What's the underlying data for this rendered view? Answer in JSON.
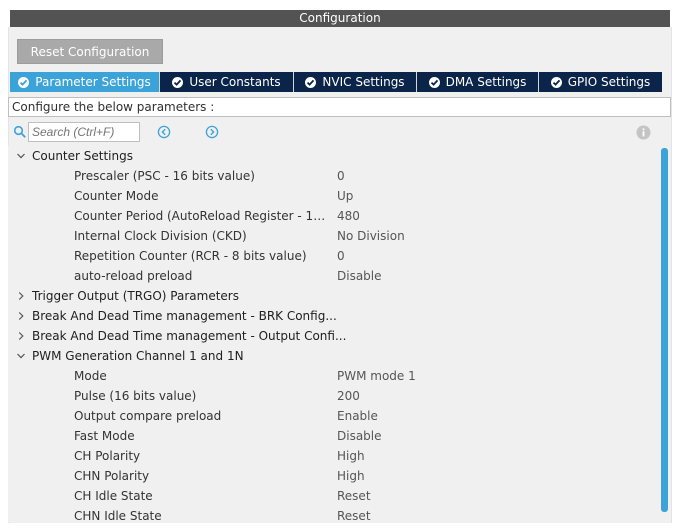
{
  "window": {
    "title": "Configuration"
  },
  "toolbar": {
    "reset_label": "Reset Configuration"
  },
  "tabs": [
    {
      "label": "Parameter Settings",
      "active": true
    },
    {
      "label": "User Constants",
      "active": false
    },
    {
      "label": "NVIC Settings",
      "active": false
    },
    {
      "label": "DMA Settings",
      "active": false
    },
    {
      "label": "GPIO Settings",
      "active": false
    }
  ],
  "description": "Configure the below parameters :",
  "search": {
    "placeholder": "Search (Ctrl+F)"
  },
  "icons": {
    "search": "search-icon",
    "prev": "arrow-left-circle-icon",
    "next": "arrow-right-circle-icon",
    "info": "info-icon",
    "expanded": "chevron-down-icon",
    "collapsed": "chevron-right-icon",
    "tab_check": "check-circle-icon"
  },
  "colors": {
    "accent": "#3ca3d8",
    "tab_bar": "#0b2449",
    "title_bar": "#535353"
  },
  "tree": {
    "counter_settings": {
      "label": "Counter Settings",
      "params": [
        {
          "name": "Prescaler (PSC - 16 bits value)",
          "value": "0"
        },
        {
          "name": "Counter Mode",
          "value": "Up"
        },
        {
          "name": "Counter Period (AutoReload Register - 16 ...",
          "value": "480"
        },
        {
          "name": "Internal Clock Division (CKD)",
          "value": "No Division"
        },
        {
          "name": "Repetition Counter (RCR - 8 bits value)",
          "value": "0"
        },
        {
          "name": "auto-reload preload",
          "value": "Disable"
        }
      ]
    },
    "trigger_output": {
      "label": "Trigger Output (TRGO) Parameters"
    },
    "brk_config": {
      "label": "Break And Dead Time management - BRK Config..."
    },
    "output_config": {
      "label": "Break And Dead Time management - Output Confi..."
    },
    "pwm_channel": {
      "label": "PWM Generation Channel 1 and 1N",
      "params": [
        {
          "name": "Mode",
          "value": "PWM mode 1"
        },
        {
          "name": "Pulse (16 bits value)",
          "value": "200"
        },
        {
          "name": "Output compare preload",
          "value": "Enable"
        },
        {
          "name": "Fast Mode",
          "value": "Disable"
        },
        {
          "name": "CH Polarity",
          "value": "High"
        },
        {
          "name": "CHN Polarity",
          "value": "High"
        },
        {
          "name": "CH Idle State",
          "value": "Reset"
        },
        {
          "name": "CHN Idle State",
          "value": "Reset"
        }
      ]
    }
  }
}
